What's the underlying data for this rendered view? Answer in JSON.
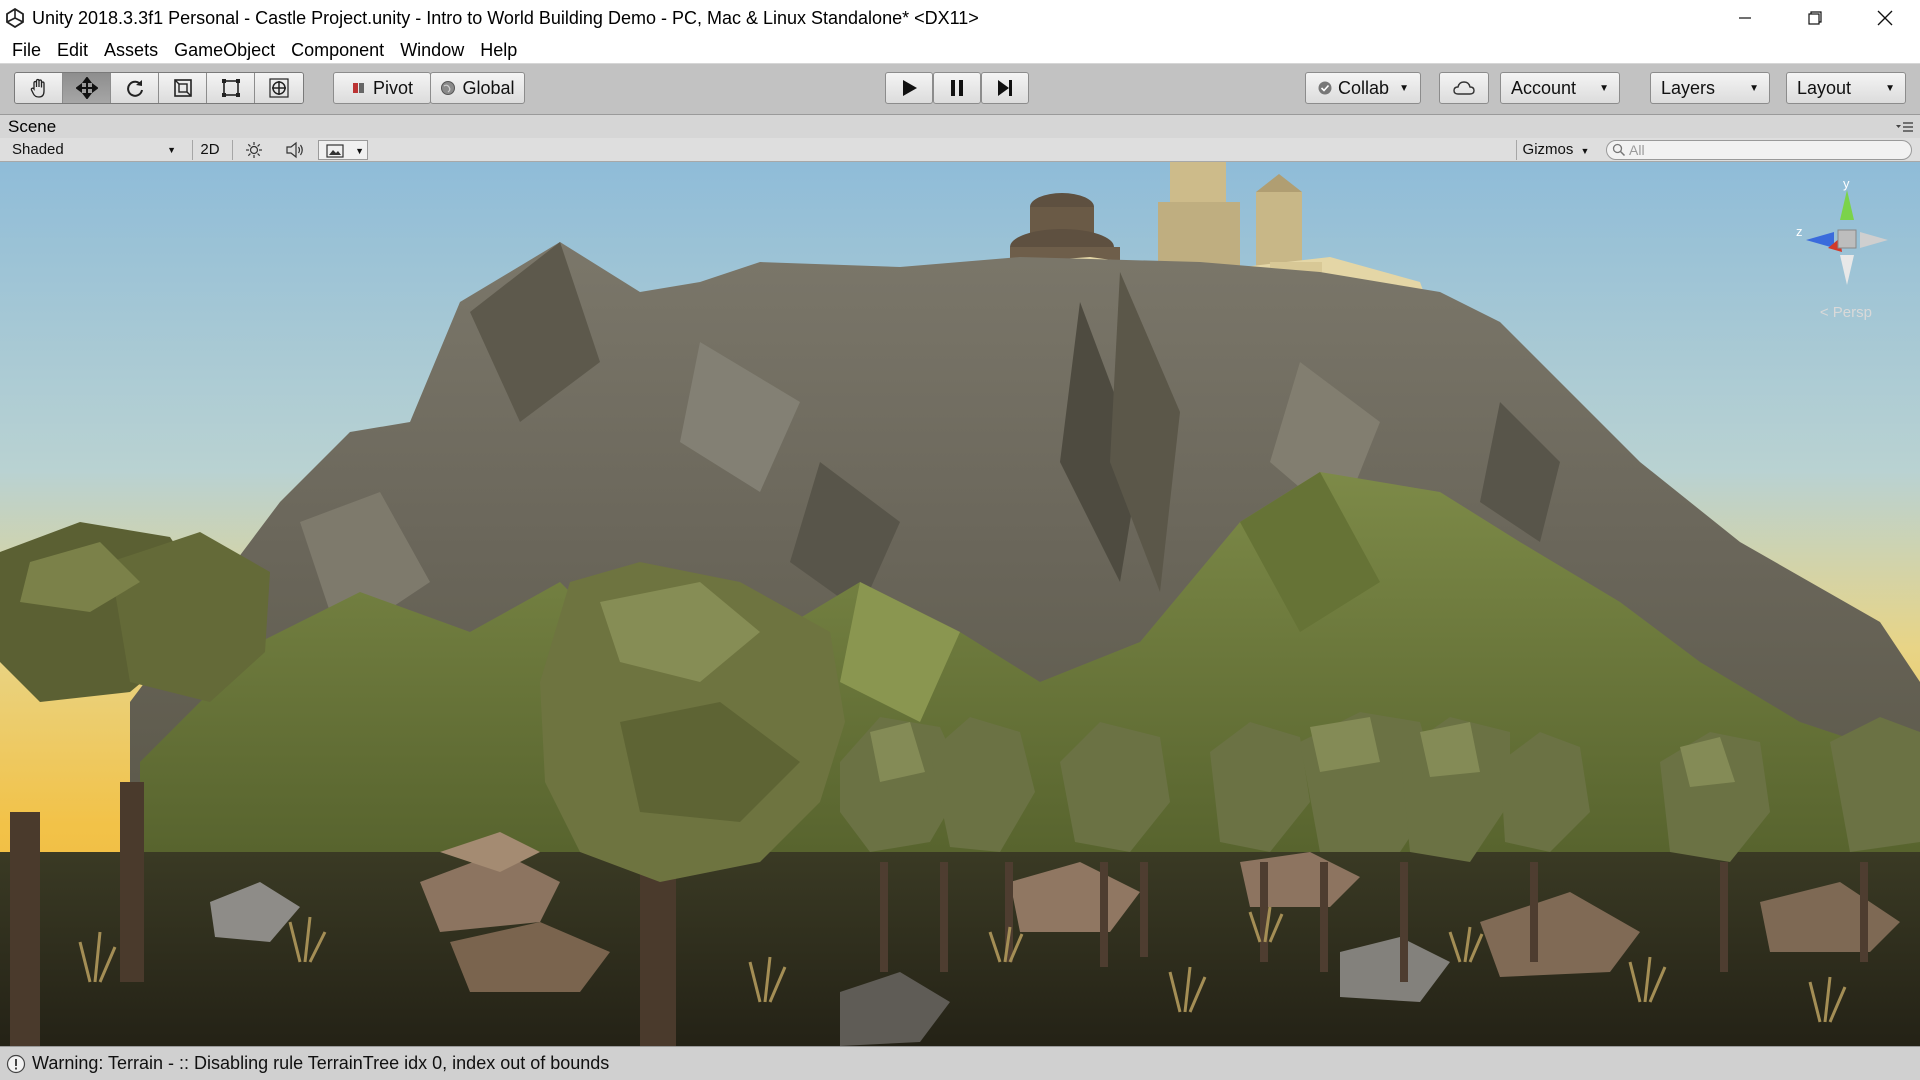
{
  "window": {
    "title": "Unity 2018.3.3f1 Personal - Castle Project.unity - Intro to World Building Demo - PC, Mac & Linux Standalone* <DX11>"
  },
  "menu": [
    "File",
    "Edit",
    "Assets",
    "GameObject",
    "Component",
    "Window",
    "Help"
  ],
  "toolbar": {
    "tools": [
      "hand-icon",
      "move-icon",
      "rotate-icon",
      "scale-icon",
      "rect-icon",
      "transform-icon"
    ],
    "active_tool": "move-icon",
    "pivot_label": "Pivot",
    "global_label": "Global",
    "collab_label": "Collab",
    "account_label": "Account",
    "layers_label": "Layers",
    "layout_label": "Layout"
  },
  "scene": {
    "tab_label": "Scene",
    "shading_mode": "Shaded",
    "mode_2d_label": "2D",
    "gizmos_label": "Gizmos",
    "search_placeholder": "All",
    "axis_y": "y",
    "axis_z": "z",
    "projection_label": "< Persp"
  },
  "status": {
    "message": "Warning: Terrain -  :: Disabling rule TerrainTree idx 0, index out of bounds"
  },
  "colors": {
    "sky_top": "#9cc4dc",
    "sky_bottom": "#f2c64a",
    "rock": "#6e6a5c",
    "grass": "#6d7a3c",
    "castle": "#e2d5a4",
    "ground": "#2b2a1c"
  }
}
